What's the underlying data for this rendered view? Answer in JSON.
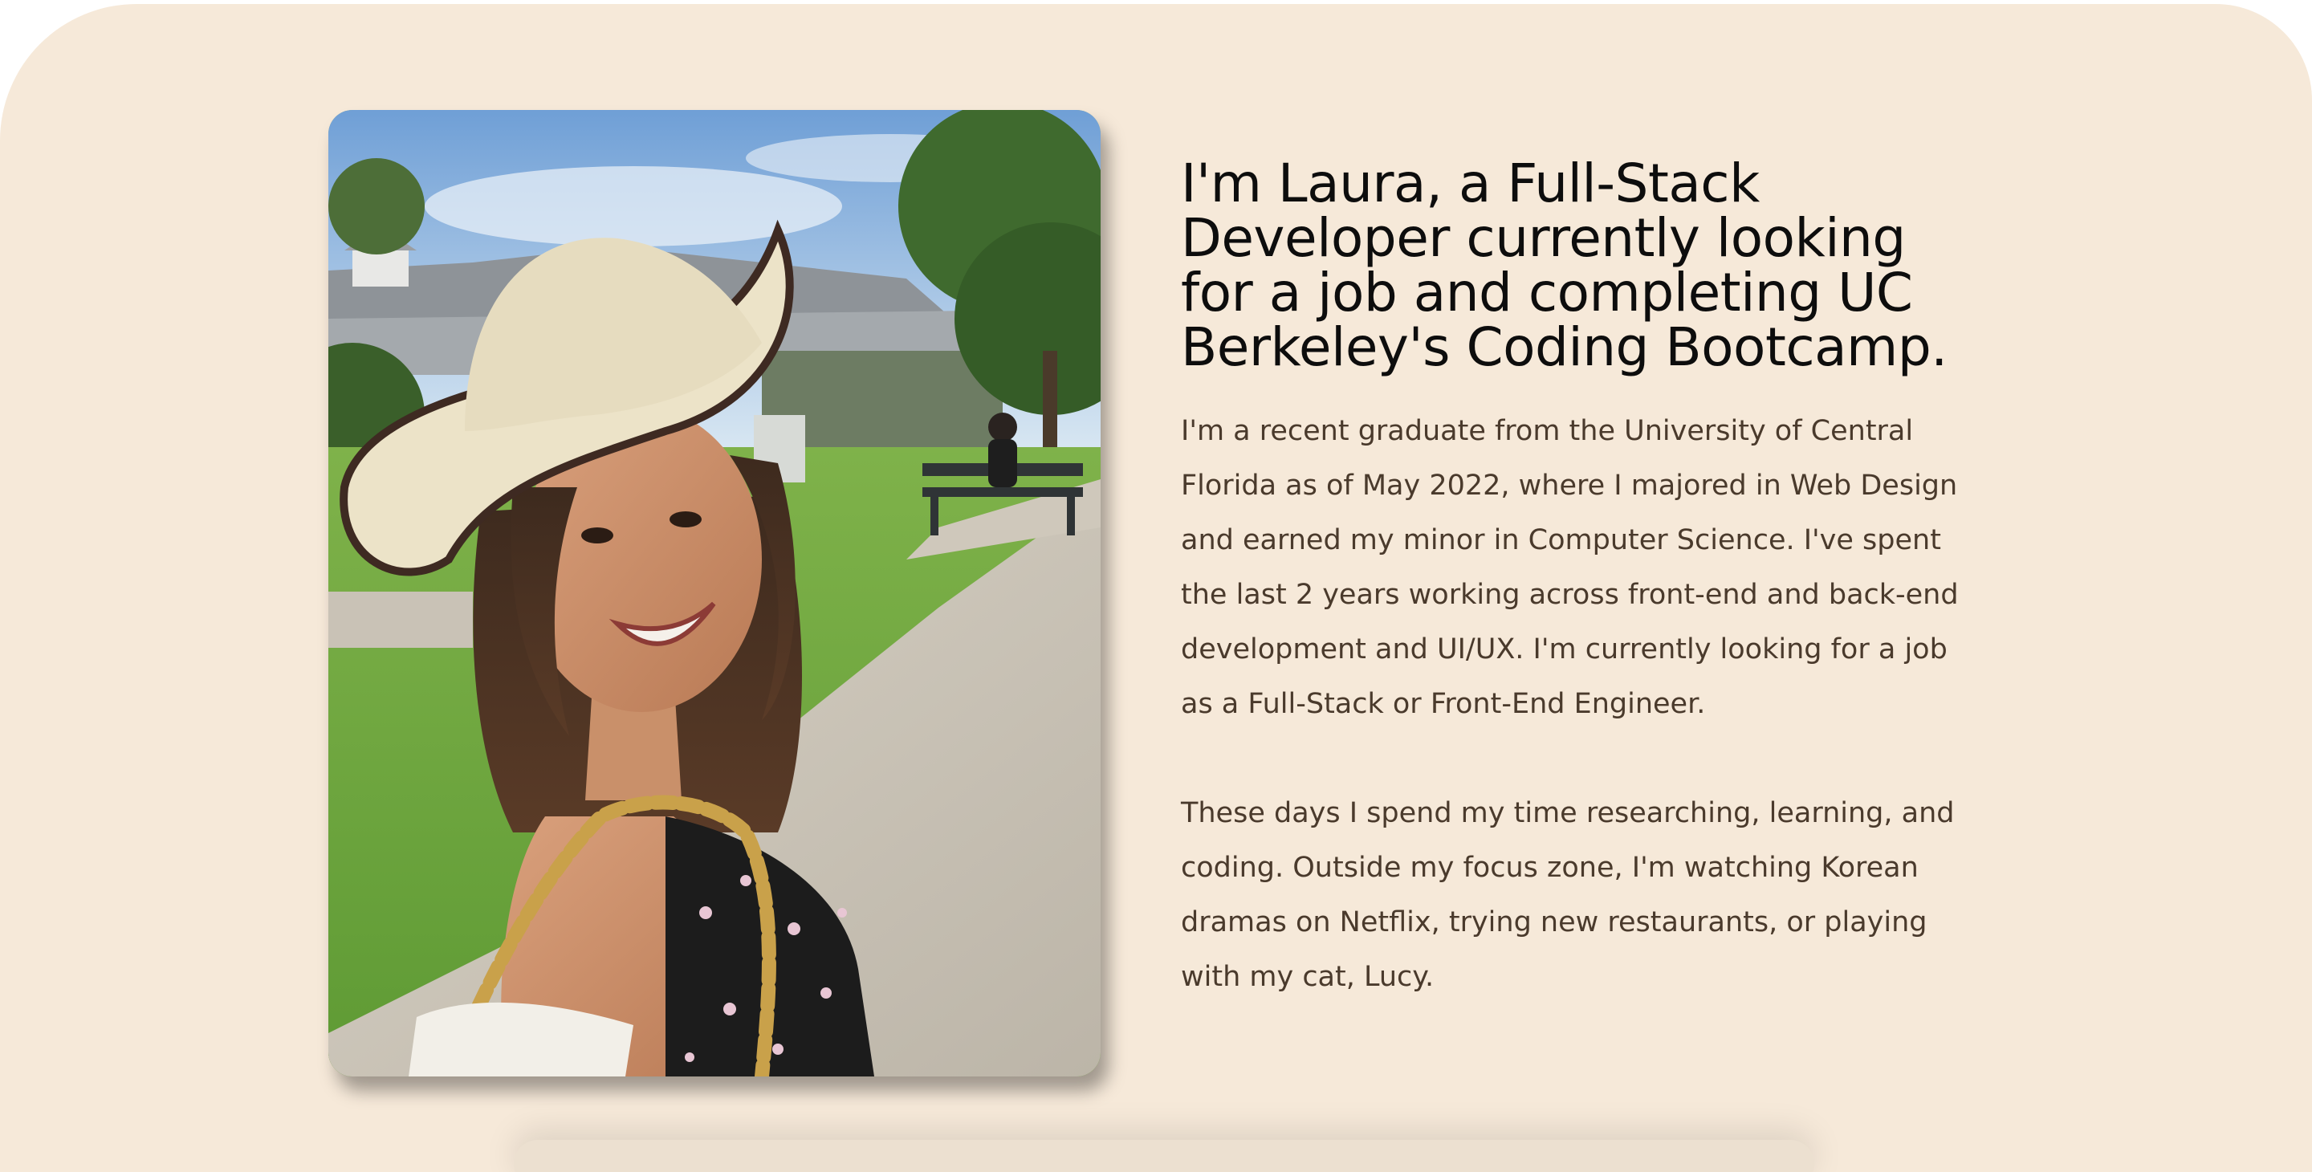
{
  "about": {
    "headline": "I'm Laura, a Full-Stack Developer currently looking for a job and completing UC Berkeley's Coding Bootcamp.",
    "paragraphs": [
      "I'm a recent graduate from the University of Central Florida as of May 2022, where I majored in Web Design and earned my minor in Computer Science. I've spent the last 2 years working across front-end and back-end development and UI/UX. I'm currently looking for a job as a Full-Stack or Front-End Engineer.",
      "These days I spend my time researching, learning, and coding. Outside my focus zone, I'm watching Korean dramas on Netflix, trying new restaurants, or playing with my cat, Lucy."
    ],
    "photo": {
      "subject": "portrait-photo"
    }
  },
  "colors": {
    "card_background": "#f6e9d9",
    "headline_text": "#0d0d0d",
    "body_text": "#4a3a2c"
  }
}
